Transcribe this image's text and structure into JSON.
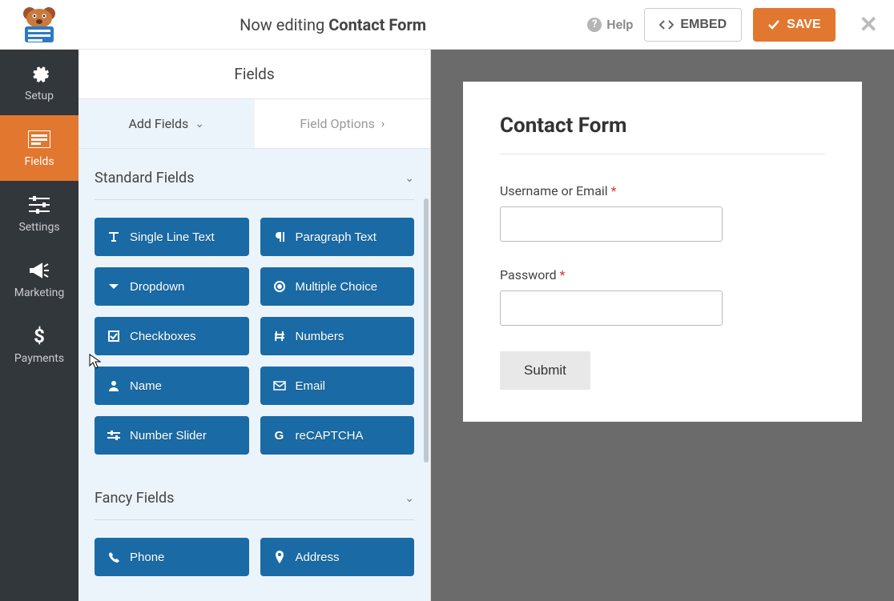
{
  "header": {
    "editing_prefix": "Now editing ",
    "form_name": "Contact Form",
    "help_label": "Help",
    "embed_label": "EMBED",
    "save_label": "SAVE"
  },
  "sidebar": {
    "items": [
      {
        "label": "Setup",
        "icon": "gear"
      },
      {
        "label": "Fields",
        "icon": "fields"
      },
      {
        "label": "Settings",
        "icon": "sliders"
      },
      {
        "label": "Marketing",
        "icon": "bullhorn"
      },
      {
        "label": "Payments",
        "icon": "dollar"
      }
    ],
    "active": 1
  },
  "center": {
    "title": "Fields",
    "tabs": {
      "add": "Add Fields",
      "options": "Field Options"
    },
    "sections": [
      {
        "title": "Standard Fields",
        "fields": [
          {
            "label": "Single Line Text",
            "icon": "text"
          },
          {
            "label": "Paragraph Text",
            "icon": "paragraph"
          },
          {
            "label": "Dropdown",
            "icon": "caret"
          },
          {
            "label": "Multiple Choice",
            "icon": "radio"
          },
          {
            "label": "Checkboxes",
            "icon": "checkbox"
          },
          {
            "label": "Numbers",
            "icon": "hash"
          },
          {
            "label": "Name",
            "icon": "user"
          },
          {
            "label": "Email",
            "icon": "envelope"
          },
          {
            "label": "Number Slider",
            "icon": "slider"
          },
          {
            "label": "reCAPTCHA",
            "icon": "google"
          }
        ]
      },
      {
        "title": "Fancy Fields",
        "fields": [
          {
            "label": "Phone",
            "icon": "phone"
          },
          {
            "label": "Address",
            "icon": "pin"
          }
        ]
      }
    ]
  },
  "preview": {
    "title": "Contact Form",
    "fields": [
      {
        "label": "Username or Email",
        "required": true
      },
      {
        "label": "Password",
        "required": true
      }
    ],
    "submit": "Submit"
  },
  "colors": {
    "accent": "#e27730",
    "field_btn": "#1a6ba5"
  }
}
